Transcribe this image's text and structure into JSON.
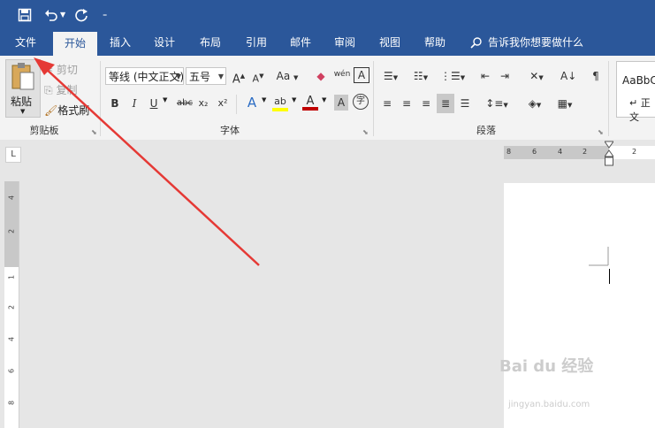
{
  "qat": {
    "save_icon": "save-icon",
    "undo_icon": "undo-icon",
    "redo_icon": "redo-icon",
    "customize_icon": "customize-icon"
  },
  "tabs": [
    {
      "label": "文件"
    },
    {
      "label": "开始"
    },
    {
      "label": "插入"
    },
    {
      "label": "设计"
    },
    {
      "label": "布局"
    },
    {
      "label": "引用"
    },
    {
      "label": "邮件"
    },
    {
      "label": "审阅"
    },
    {
      "label": "视图"
    },
    {
      "label": "帮助"
    }
  ],
  "tell_me": "告诉我你想要做什么",
  "clipboard": {
    "paste": "粘贴",
    "cut": "剪切",
    "copy": "复制",
    "format_painter": "格式刷",
    "group": "剪贴板"
  },
  "font": {
    "family": "等线 (中文正文)",
    "size": "五号",
    "grow": "A",
    "shrink": "A",
    "case": "Aa",
    "wen": "wén",
    "bold": "B",
    "italic": "I",
    "underline": "U",
    "strike": "abc",
    "subscript": "x₂",
    "superscript": "x²",
    "effects": "A",
    "highlight": "ab",
    "font_color": "A",
    "char_shading": "A",
    "enclose": "字",
    "group": "字体"
  },
  "paragraph": {
    "group": "段落"
  },
  "styles": {
    "sample": "AaBbC",
    "name": "正文"
  },
  "ruler": {
    "h_numbers": [
      "8",
      "6",
      "4",
      "2",
      "2"
    ],
    "v_numbers": [
      "4",
      "2",
      "1",
      "2",
      "4",
      "6",
      "8"
    ],
    "tab_selector": "L"
  },
  "watermark": {
    "main": "Bai du 经验",
    "sub": "jingyan.baidu.com"
  },
  "colors": {
    "accent": "#2b579a",
    "ribbon_bg": "#f3f3f3",
    "annotation_arrow": "#e53935"
  }
}
